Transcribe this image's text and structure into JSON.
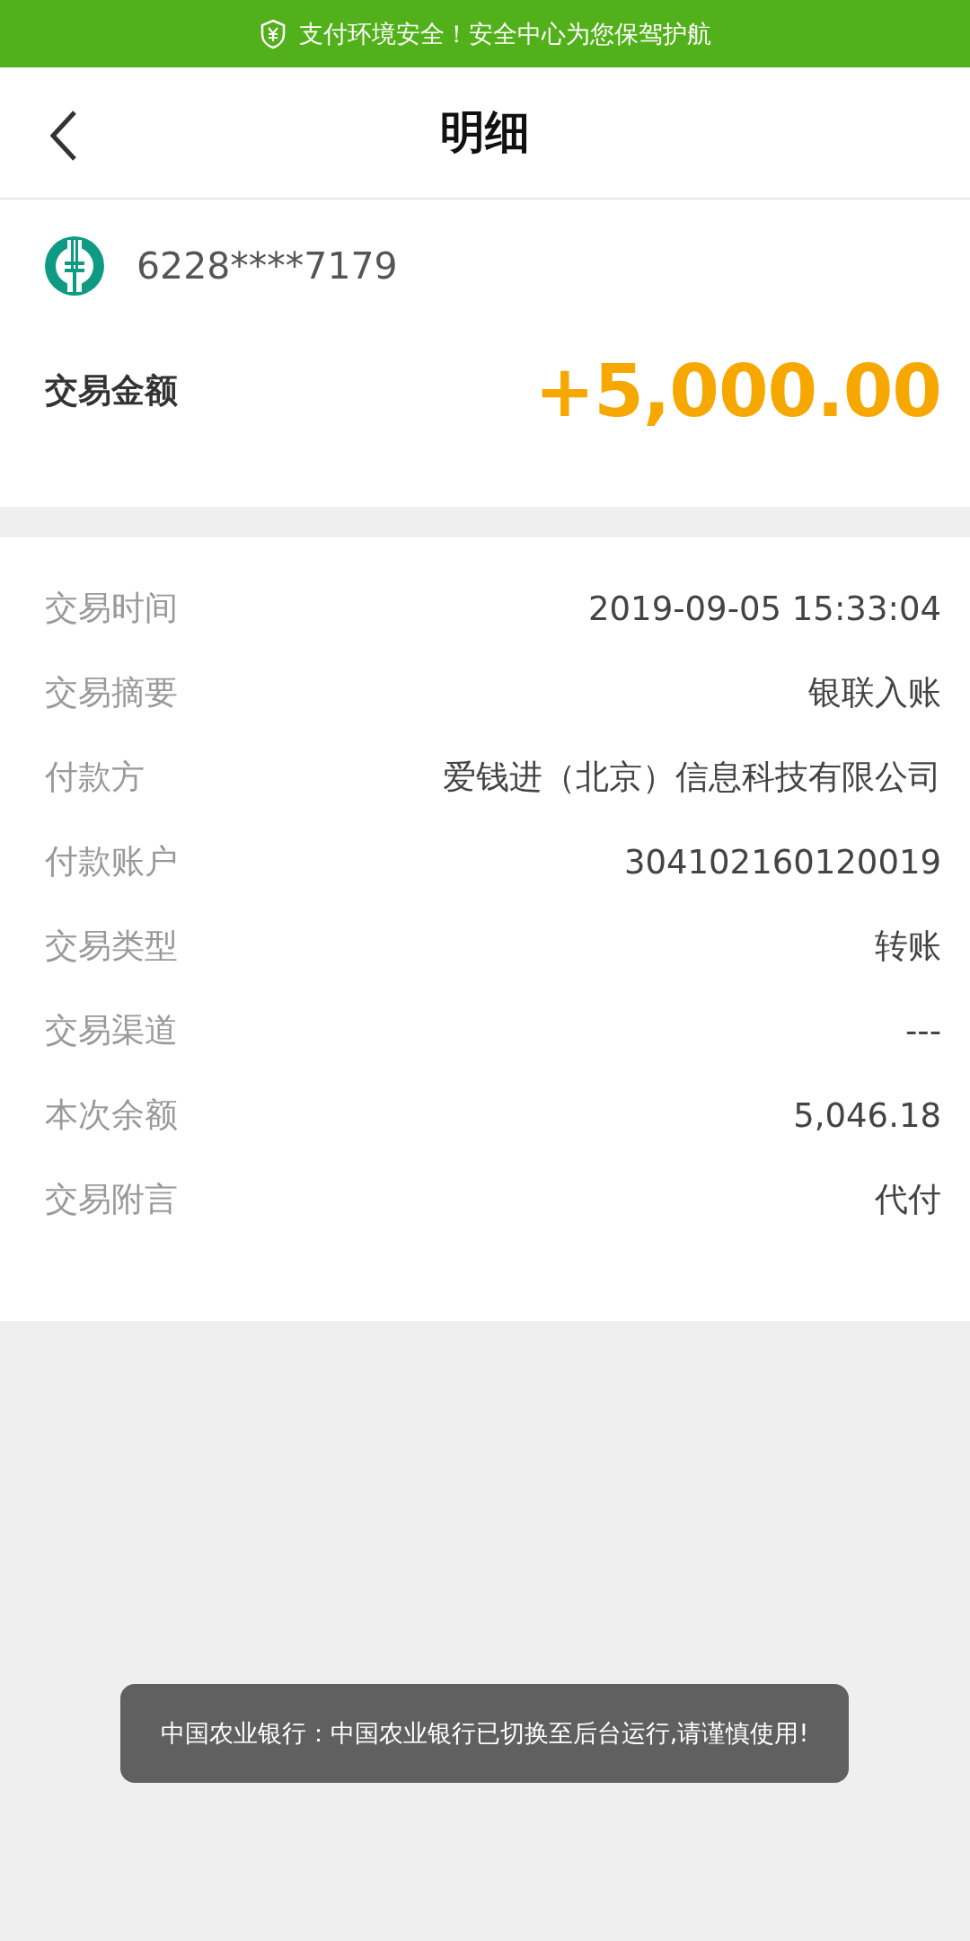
{
  "security_banner": {
    "text": "支付环境安全！安全中心为您保驾护航"
  },
  "header": {
    "title": "明细"
  },
  "account": {
    "card_number": "6228****7179"
  },
  "amount": {
    "label": "交易金额",
    "value": "+5,000.00"
  },
  "details": [
    {
      "label": "交易时间",
      "value": "2019-09-05 15:33:04"
    },
    {
      "label": "交易摘要",
      "value": "银联入账"
    },
    {
      "label": "付款方",
      "value": "爱钱进（北京）信息科技有限公司"
    },
    {
      "label": "付款账户",
      "value": "304102160120019"
    },
    {
      "label": "交易类型",
      "value": "转账"
    },
    {
      "label": "交易渠道",
      "value": "---"
    },
    {
      "label": "本次余额",
      "value": "5,046.18"
    },
    {
      "label": "交易附言",
      "value": "代付"
    }
  ],
  "toast": {
    "text": "中国农业银行：中国农业银行已切换至后台运行,请谨慎使用!"
  }
}
